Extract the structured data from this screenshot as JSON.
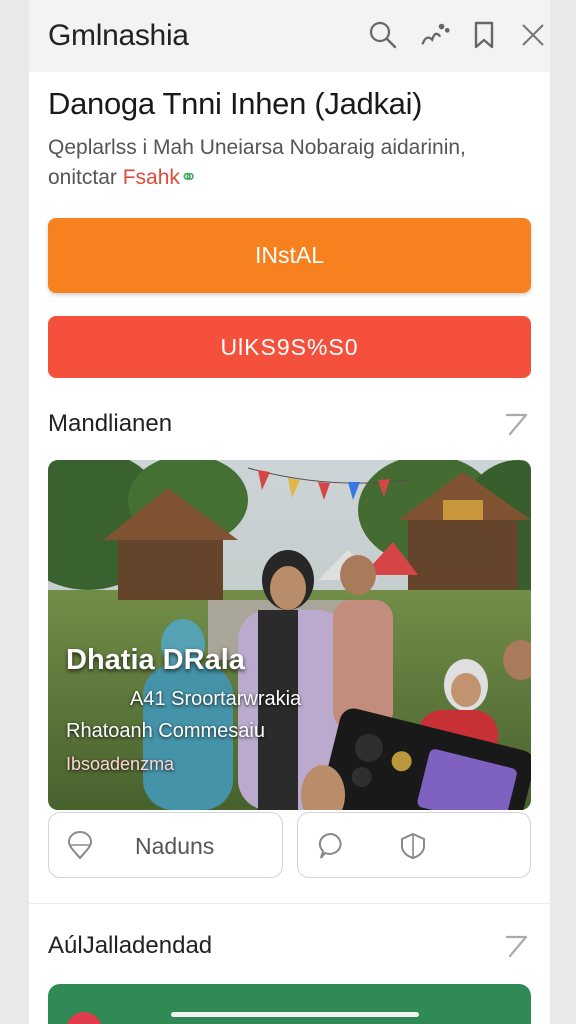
{
  "header": {
    "app_name": "Gmlnashia"
  },
  "app": {
    "title": "Danoga Tnni Inhen (Jadkai)",
    "description_line1": "Qeplarlss i Mah Uneiarsa Nobaraig aidarinin,",
    "description_line2_prefix": "onitctar ",
    "description_line2_highlight": "Fsahk"
  },
  "actions": {
    "install_label": "INstAL",
    "uninstall_label": "UlKS9S%S0"
  },
  "section_media": {
    "title": "Mandlianen"
  },
  "media": {
    "overlay_title": "Dhatia DRala",
    "overlay_sub1": "A41  Sroortarwrakia",
    "overlay_sub2": "Rhatoanh Commesaiu",
    "overlay_sub3": "Ibsoadenzma"
  },
  "media_actions": {
    "left_label": "Naduns"
  },
  "section_related": {
    "title": "AúlJalladendad"
  },
  "icons": {
    "search": "search-icon",
    "share": "share-icon",
    "bookmark": "bookmark-icon",
    "close": "close-icon",
    "arrow": "arrow-icon"
  },
  "colors": {
    "install": "#f7801f",
    "uninstall": "#f4503c",
    "related_card": "#2f8a55"
  }
}
